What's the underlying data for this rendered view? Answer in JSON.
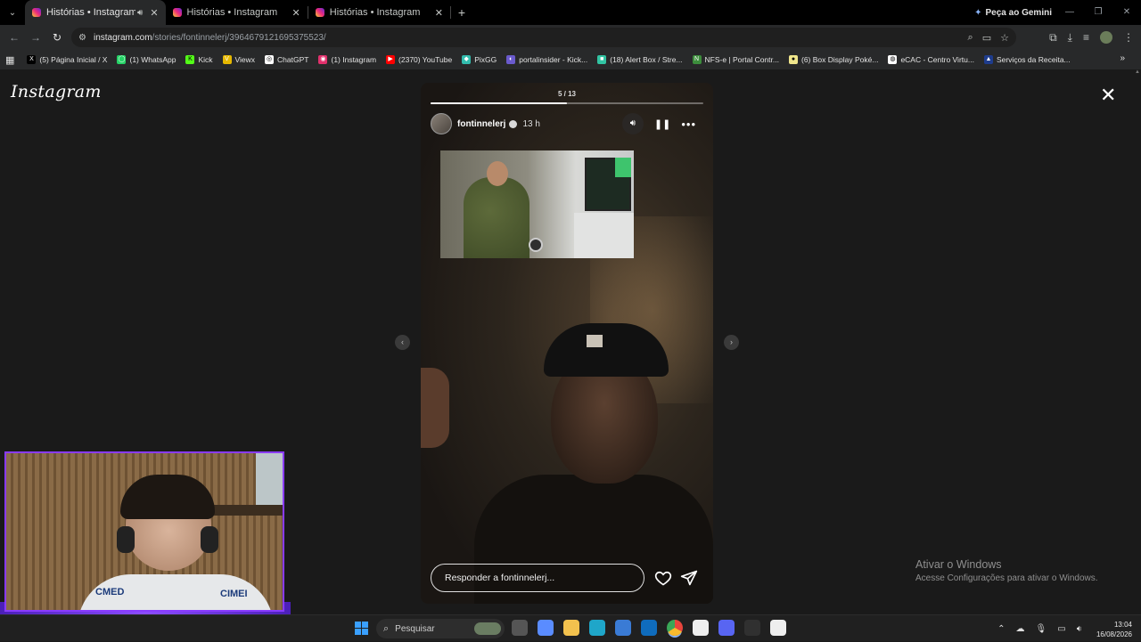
{
  "browser": {
    "tabs": [
      {
        "label": "Histórias • Instagram",
        "active": true
      },
      {
        "label": "Histórias • Instagram",
        "active": false
      },
      {
        "label": "Histórias • Instagram",
        "active": false
      }
    ],
    "gemini_label": "Peça ao Gemini",
    "url_host": "instagram.com",
    "url_path": "/stories/fontinnelerj/3964679121695375523/",
    "bookmarks": [
      {
        "label": "(5) Página Inicial / X",
        "color": "#000000",
        "glyph": "X"
      },
      {
        "label": "(1) WhatsApp",
        "color": "#25d366",
        "glyph": "◯"
      },
      {
        "label": "Kick",
        "color": "#53fc18",
        "glyph": "K"
      },
      {
        "label": "Viewx",
        "color": "#e6b800",
        "glyph": "V"
      },
      {
        "label": "ChatGPT",
        "color": "#ffffff",
        "glyph": "◎"
      },
      {
        "label": "(1) Instagram",
        "color": "#e1306c",
        "glyph": "◉"
      },
      {
        "label": "(2370) YouTube",
        "color": "#ff0000",
        "glyph": "▶"
      },
      {
        "label": "PixGG",
        "color": "#32bcad",
        "glyph": "◆"
      },
      {
        "label": "portalinsider - Kick...",
        "color": "#6a5acd",
        "glyph": "◐"
      },
      {
        "label": "(18) Alert Box / Stre...",
        "color": "#31c3a2",
        "glyph": "■"
      },
      {
        "label": "NFS-e | Portal Contr...",
        "color": "#3c8d3c",
        "glyph": "N"
      },
      {
        "label": "(6) Box Display Poké...",
        "color": "#f0e68c",
        "glyph": "●"
      },
      {
        "label": "eCAC - Centro Virtu...",
        "color": "#ffffff",
        "glyph": "◍"
      },
      {
        "label": "Serviços da Receita...",
        "color": "#1e3c8c",
        "glyph": "▲"
      }
    ]
  },
  "instagram": {
    "logo": "Instagram",
    "story": {
      "counter": "5 / 13",
      "progress": 0.5,
      "username": "fontinnelerj",
      "time": "13 h",
      "reply_placeholder": "Responder a fontinnelerj..."
    }
  },
  "watermark": {
    "line1": "Ativar o Windows",
    "line2": "Acesse Configurações para ativar o Windows."
  },
  "webcam": {
    "shirt_text_left": "CMED",
    "shirt_text_right": "CIMEI"
  },
  "taskbar": {
    "search_placeholder": "Pesquisar",
    "apps": [
      {
        "name": "task-view",
        "color": "#555555"
      },
      {
        "name": "copilot",
        "color": "#5a8cff"
      },
      {
        "name": "file-explorer",
        "color": "#f2c14e"
      },
      {
        "name": "edge",
        "color": "#1fa6c9"
      },
      {
        "name": "store",
        "color": "#3a7bd5"
      },
      {
        "name": "outlook",
        "color": "#0f6cbd"
      },
      {
        "name": "chrome",
        "color": "#e8453c"
      },
      {
        "name": "capcut",
        "color": "#eeeeee"
      },
      {
        "name": "discord",
        "color": "#5865f2"
      },
      {
        "name": "obs",
        "color": "#303030"
      },
      {
        "name": "capcut-2",
        "color": "#eeeeee"
      }
    ],
    "time": "13:04",
    "date": "16/08/2026"
  }
}
